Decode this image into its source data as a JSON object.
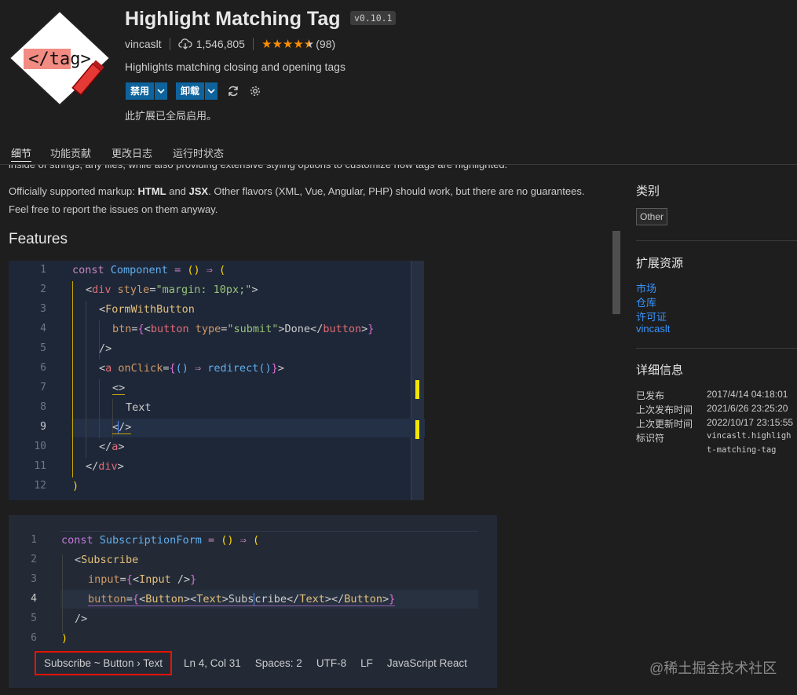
{
  "header": {
    "logo_text": "</tag>",
    "title": "Highlight Matching Tag",
    "version": "v0.10.1",
    "publisher": "vincaslt",
    "installs": "1,546,805",
    "rating_stars": 4.5,
    "rating_count": "(98)",
    "description": "Highlights matching closing and opening tags",
    "disable_label": "禁用",
    "uninstall_label": "卸载",
    "status": "此扩展已全局启用。"
  },
  "tabs": [
    "细节",
    "功能贡献",
    "更改日志",
    "运行时状态"
  ],
  "readme": {
    "cut_line": "inside of strings, any files, while also providing extensive styling options to customize how tags are highlighted.",
    "p1_a": "Officially supported markup: ",
    "p1_html": "HTML",
    "p1_and": " and ",
    "p1_jsx": "JSX",
    "p1_b": ". Other flavors (XML, Vue, Angular, PHP) should work, but there are no guarantees.",
    "p2": "Feel free to report the issues on them anyway.",
    "features_heading": "Features"
  },
  "code1": {
    "line_numbers": [
      "1",
      "2",
      "3",
      "4",
      "5",
      "6",
      "7",
      "8",
      "9",
      "10",
      "11",
      "12"
    ],
    "current_line": "9"
  },
  "code2": {
    "line_numbers": [
      "1",
      "2",
      "3",
      "4",
      "5",
      "6"
    ],
    "current_line": "4"
  },
  "statusbar": {
    "breadcrumb": "Subscribe ~ Button › Text",
    "position": "Ln 4, Col 31",
    "spaces": "Spaces: 2",
    "encoding": "UTF-8",
    "eol": "LF",
    "language": "JavaScript React"
  },
  "sidebar": {
    "categories_heading": "类别",
    "category": "Other",
    "resources_heading": "扩展资源",
    "links": [
      "市场",
      "仓库",
      "许可证",
      "vincaslt"
    ],
    "details_heading": "详细信息",
    "details": [
      {
        "key": "已发布",
        "value": "2017/4/14 04:18:01"
      },
      {
        "key": "上次发布时间",
        "value": "2021/6/26 23:25:20"
      },
      {
        "key": "上次更新时间",
        "value": "2022/10/17 23:15:55"
      },
      {
        "key": "标识符",
        "value": "vincaslt.highlight-matching-tag"
      }
    ]
  },
  "watermark": "@稀土掘金技术社区",
  "colors": {
    "background": "#1e1e1e",
    "accent_button": "#0e639c",
    "link": "#3794ff",
    "star": "#ff8e00",
    "highlight_box": "#e51400"
  }
}
